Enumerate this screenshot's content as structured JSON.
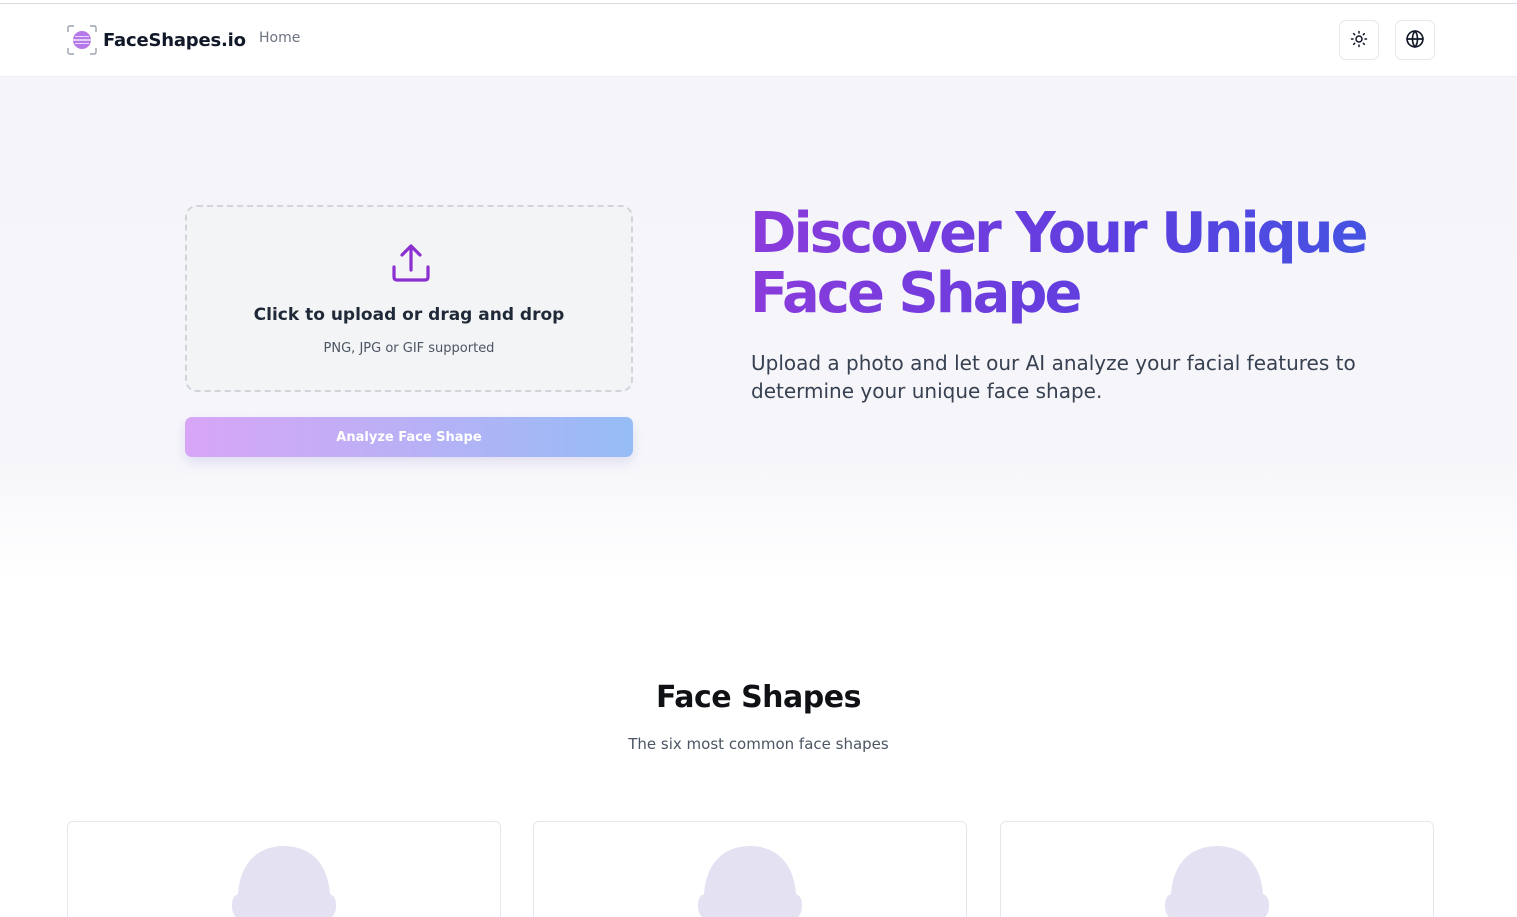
{
  "header": {
    "brand": "FaceShapes.io",
    "nav": [
      {
        "label": "Home"
      }
    ],
    "actions": [
      {
        "name": "theme-toggle",
        "icon": "sun-icon"
      },
      {
        "name": "language-select",
        "icon": "globe-icon"
      }
    ]
  },
  "upload": {
    "icon": "upload-icon",
    "title": "Click to upload or drag and drop",
    "subtitle": "PNG, JPG or GIF supported",
    "button_label": "Analyze Face Shape"
  },
  "hero": {
    "title_line1": "Discover Your Unique",
    "title_line2": "Face Shape",
    "description": "Upload a photo and let our AI analyze your facial features to determine your unique face shape."
  },
  "face_shapes": {
    "title": "Face Shapes",
    "subtitle": "The six most common face shapes",
    "cards": [
      {
        "icon": "face-silhouette-icon"
      },
      {
        "icon": "face-silhouette-icon"
      },
      {
        "icon": "face-silhouette-icon"
      }
    ]
  },
  "colors": {
    "brand_purple": "#8b3bdb",
    "brand_blue": "#3f5ae2",
    "icon_purple": "#8b2fd0",
    "silhouette": "#e4e2f2",
    "button_gradient_start": "#d8a6f6",
    "button_gradient_end": "#96bdf6"
  }
}
